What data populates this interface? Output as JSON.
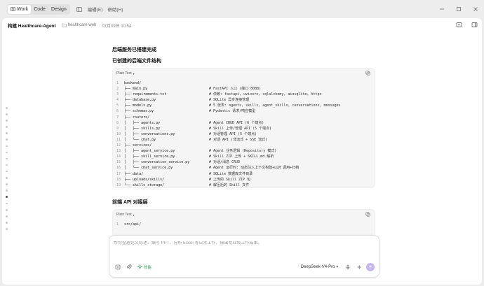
{
  "topbar": {
    "modes": [
      {
        "label": "Work",
        "active": true
      },
      {
        "label": "Code",
        "active": false
      },
      {
        "label": "Design",
        "active": false
      }
    ],
    "menus": [
      "编辑(E)",
      "帮助(H)"
    ],
    "controls": [
      "minimize-icon",
      "maximize-icon",
      "close-icon"
    ]
  },
  "header": {
    "title": "构建 Healthcare-Agent",
    "folder": "healthcare web",
    "time": "07月09日 10:54"
  },
  "sections": {
    "s1_title": "后端服务已搭建完成",
    "s2_title": "已创建的后端文件结构",
    "s3_title": "前端 API 对接层"
  },
  "code1": {
    "lang": "Plain Text",
    "lines": [
      {
        "n": "1",
        "t": "backend/",
        "c": ""
      },
      {
        "n": "2",
        "t": "├── main.py",
        "c": "# FastAPI 入口 (端口 8088)"
      },
      {
        "n": "3",
        "t": "├── requirements.txt",
        "c": "# 依赖: fastapi, uvicorn, sqlalchemy, aiosqlite, httpx"
      },
      {
        "n": "4",
        "t": "├── database.py",
        "c": "# SQLite 异步连接管理"
      },
      {
        "n": "5",
        "t": "├── models.py",
        "c": "# 5 张表: agents, skills, agent_skills, conversations, messages"
      },
      {
        "n": "6",
        "t": "├── schemas.py",
        "c": "# Pydantic 请求/响应模型"
      },
      {
        "n": "7",
        "t": "├── routers/",
        "c": ""
      },
      {
        "n": "8",
        "t": "│   ├── agents.py",
        "c": "# Agent CRUD API (6 个端点)"
      },
      {
        "n": "9",
        "t": "│   ├── skills.py",
        "c": "# Skill 上传/管理 API (5 个端点)"
      },
      {
        "n": "10",
        "t": "│   ├── conversations.py",
        "c": "# 对话管理 API (5 个端点)"
      },
      {
        "n": "11",
        "t": "│   └── chat.py",
        "c": "# 对话 API (非流式 + SSE 流式)"
      },
      {
        "n": "12",
        "t": "├── services/",
        "c": ""
      },
      {
        "n": "13",
        "t": "│   ├── agent_service.py",
        "c": "# Agent 业务逻辑 (Repository 模式)"
      },
      {
        "n": "14",
        "t": "│   ├── skill_service.py",
        "c": "# Skill ZIP 上传 + SKILL.md 解析"
      },
      {
        "n": "15",
        "t": "│   ├── conversation_service.py",
        "c": "# 对话/消息 CRUD"
      },
      {
        "n": "16",
        "t": "│   └── chat_service.py",
        "c": "# Agent 运行时: 动态注入上下文构建+LLM 调用+归档"
      },
      {
        "n": "17",
        "t": "├── data/",
        "c": "# SQLite 数据库文件目录"
      },
      {
        "n": "18",
        "t": "├── uploads/skills/",
        "c": "# 上传的 Skill ZIP 包"
      },
      {
        "n": "19",
        "t": "└── skills_storage/",
        "c": "# 解压后的 Skill 文件"
      }
    ]
  },
  "code2": {
    "lang": "Plain Text",
    "lines": [
      {
        "n": "1",
        "t": "src/api/",
        "c": ""
      }
    ]
  },
  "composer": {
    "placeholder": "帮你整理论文综述、编写 PPT、分析 Excel 等日常工作、输出专业级工作成果。",
    "skill_label": "技能",
    "model": "DeepSeek-V4-Pro"
  },
  "colors": {
    "accent_send": "#c7b7ef",
    "skill_green": "#2aa05a",
    "background": "#ededed"
  }
}
